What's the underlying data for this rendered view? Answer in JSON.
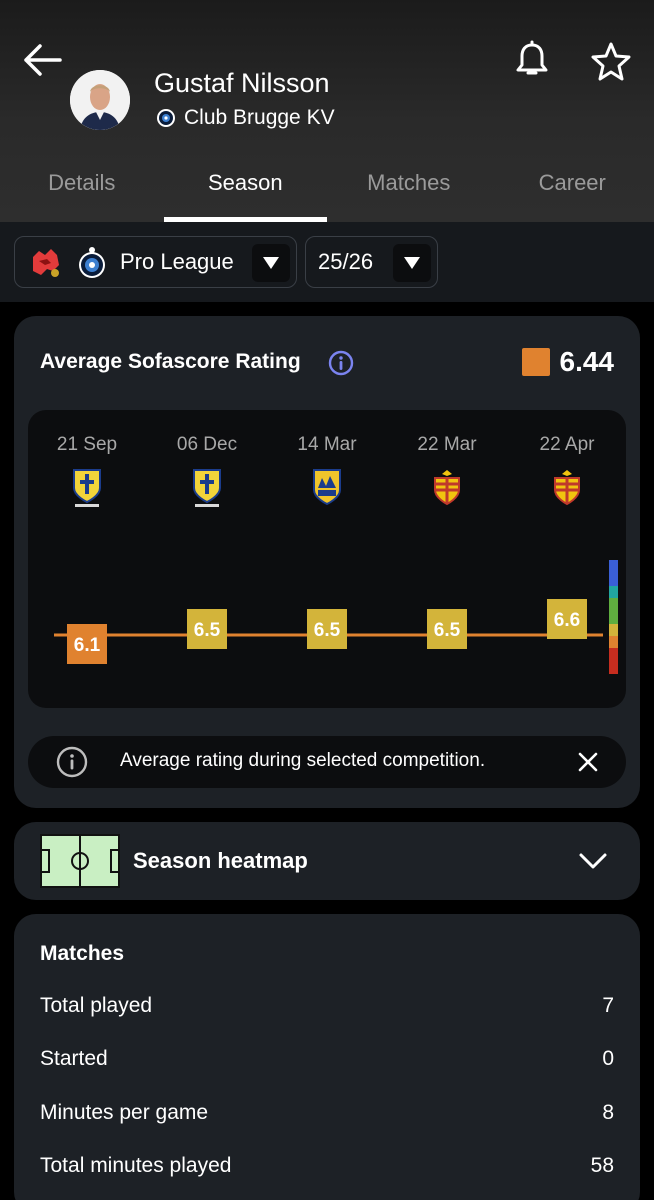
{
  "player": {
    "name": "Gustaf Nilsson",
    "club": "Club Brugge KV"
  },
  "header_icons": [
    "back-arrow-icon",
    "bell-icon",
    "star-icon"
  ],
  "tabs": [
    {
      "label": "Details",
      "active": false
    },
    {
      "label": "Season",
      "active": true
    },
    {
      "label": "Matches",
      "active": false
    },
    {
      "label": "Career",
      "active": false
    }
  ],
  "filters": {
    "league": "Pro League",
    "season": "25/26"
  },
  "rating_card": {
    "title": "Average Sofascore Rating",
    "average": "6.44",
    "average_color": "#e0822f",
    "note": "Average rating during selected competition."
  },
  "chart_data": {
    "type": "line",
    "x": [
      "21 Sep",
      "06 Dec",
      "14 Mar",
      "22 Mar",
      "22 Apr"
    ],
    "opponent_icons": [
      "stvv-crest-icon",
      "stvv-crest-icon",
      "westerlo-crest-icon",
      "kv-mechelen-crest-icon",
      "kv-mechelen-crest-icon"
    ],
    "series": [
      {
        "values": [
          6.1,
          6.5,
          6.5,
          6.5,
          6.6
        ]
      }
    ],
    "reference_line": 6.44,
    "colors": {
      "orange": "#e0822f",
      "yellow": "#d3b43a",
      "line": "#e0822f"
    },
    "scale_colors": [
      "#c62d1f",
      "#e0822f",
      "#d3b43a",
      "#5fae3f",
      "#21a6a0",
      "#3a5fd6"
    ]
  },
  "heatmap": {
    "title": "Season heatmap"
  },
  "matches": {
    "title": "Matches",
    "rows": [
      {
        "label": "Total played",
        "value": "7"
      },
      {
        "label": "Started",
        "value": "0"
      },
      {
        "label": "Minutes per game",
        "value": "8"
      },
      {
        "label": "Total minutes played",
        "value": "58"
      }
    ]
  }
}
